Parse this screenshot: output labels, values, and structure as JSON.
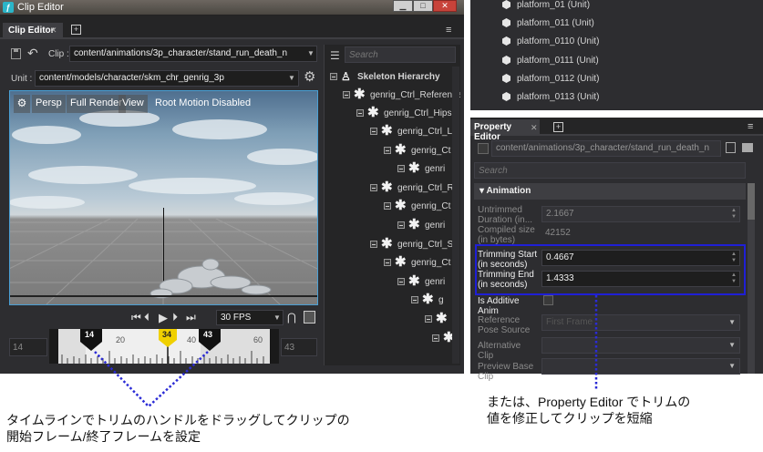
{
  "clip_editor": {
    "window_title": "Clip Editor",
    "tab_label": "Clip Editor",
    "clip_label": "Clip :",
    "clip_path": "content/animations/3p_character/stand_run_death_n",
    "unit_label": "Unit :",
    "unit_path": "content/models/character/skm_chr_genrig_3p",
    "viewport": {
      "persp": "Persp",
      "full_render": "Full Render",
      "view": "View",
      "root_motion": "Root Motion Disabled"
    },
    "fps": "30 FPS",
    "timeline": {
      "start_field": "14",
      "end_field": "43",
      "ticks": [
        "20",
        "40",
        "60"
      ],
      "trim_start": "14",
      "current": "34",
      "trim_end": "43"
    }
  },
  "skeleton": {
    "search_placeholder": "Search",
    "items": [
      {
        "label": "Skeleton Hierarchy"
      },
      {
        "label": "genrig_Ctrl_Reference"
      },
      {
        "label": "genrig_Ctrl_Hips"
      },
      {
        "label": "genrig_Ctrl_Le"
      },
      {
        "label": "genrig_Ct"
      },
      {
        "label": "genri"
      },
      {
        "label": "genrig_Ctrl_R"
      },
      {
        "label": "genrig_Ct"
      },
      {
        "label": "genri"
      },
      {
        "label": "genrig_Ctrl_Sp"
      },
      {
        "label": "genrig_Ct"
      },
      {
        "label": "genri"
      },
      {
        "label": "g"
      },
      {
        "label": ""
      },
      {
        "label": ""
      }
    ]
  },
  "unit_list": [
    {
      "label": "platform_01 (Unit)"
    },
    {
      "label": "platform_011 (Unit)"
    },
    {
      "label": "platform_0110 (Unit)"
    },
    {
      "label": "platform_0111 (Unit)"
    },
    {
      "label": "platform_0112 (Unit)"
    },
    {
      "label": "platform_0113 (Unit)"
    }
  ],
  "property_editor": {
    "tab_label": "Property Editor",
    "path": "content/animations/3p_character/stand_run_death_n",
    "search_placeholder": "Search",
    "section": "Animation",
    "rows": [
      {
        "label": "Untrimmed Duration (in...",
        "value": "2.1667"
      },
      {
        "label": "Compiled size (in bytes)",
        "value": "42152"
      },
      {
        "label": "Trimming Start (in seconds)",
        "value": "0.4667"
      },
      {
        "label": "Trimming End (in seconds)",
        "value": "1.4333"
      },
      {
        "label": "Is Additive Anim",
        "value": ""
      },
      {
        "label": "Reference Pose Source",
        "value": "First Frame"
      },
      {
        "label": "Alternative Clip",
        "value": ""
      },
      {
        "label": "Preview Base Clip",
        "value": ""
      }
    ]
  },
  "captions": {
    "left_line1": "タイムラインでトリムのハンドルをドラッグしてクリップの",
    "left_line2": "開始フレーム/終了フレームを設定",
    "right_line1": "または、Property Editor でトリムの",
    "right_line2": "値を修正してクリップを短縮"
  },
  "colors": {
    "panel_bg": "#2d2d30",
    "accent": "#4a9fd4",
    "playhead": "#f0d000",
    "highlight": "#1f1fd6",
    "callout": "#2b2bd6"
  }
}
